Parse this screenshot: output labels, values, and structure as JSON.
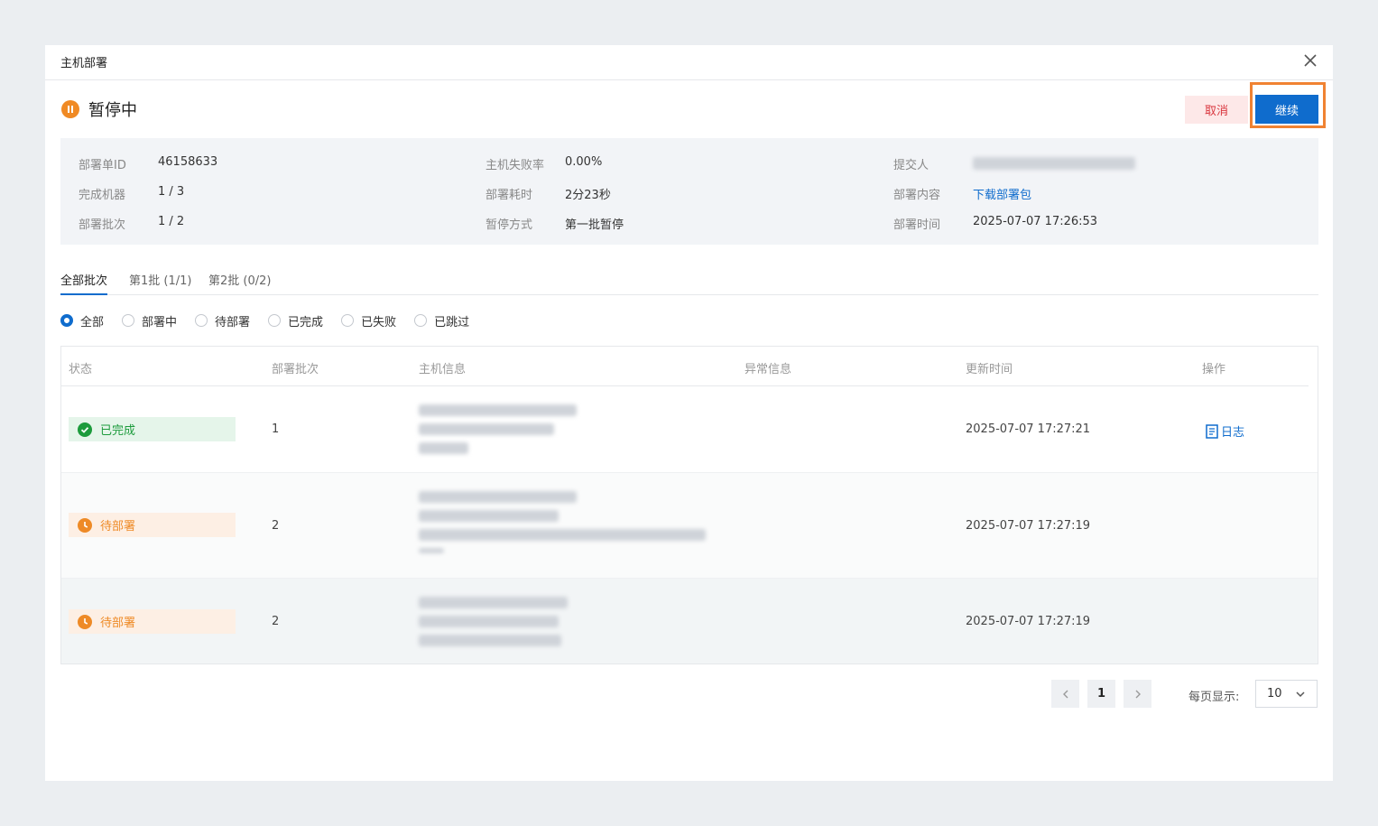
{
  "dialog": {
    "title": "主机部署"
  },
  "status": {
    "text": "暂停中"
  },
  "actions": {
    "cancel_label": "取消",
    "continue_label": "继续"
  },
  "info": {
    "deploy_id_label": "部署单ID",
    "deploy_id": "46158633",
    "machines_label": "完成机器",
    "machines": "1 / 3",
    "batch_label": "部署批次",
    "batch": "1 / 2",
    "fail_rate_label": "主机失败率",
    "fail_rate": "0.00%",
    "duration_label": "部署耗时",
    "duration": "2分23秒",
    "pause_mode_label": "暂停方式",
    "pause_mode": "第一批暂停",
    "submitter_label": "提交人",
    "content_label": "部署内容",
    "content_link": "下载部署包",
    "time_label": "部署时间",
    "time": "2025-07-07 17:26:53"
  },
  "tabs": [
    {
      "label": "全部批次",
      "active": true
    },
    {
      "label": "第1批 (1/1)",
      "active": false
    },
    {
      "label": "第2批 (0/2)",
      "active": false
    }
  ],
  "filters": [
    {
      "label": "全部",
      "checked": true
    },
    {
      "label": "部署中",
      "checked": false
    },
    {
      "label": "待部署",
      "checked": false
    },
    {
      "label": "已完成",
      "checked": false
    },
    {
      "label": "已失败",
      "checked": false
    },
    {
      "label": "已跳过",
      "checked": false
    }
  ],
  "table": {
    "columns": [
      "状态",
      "部署批次",
      "主机信息",
      "异常信息",
      "更新时间",
      "操作"
    ],
    "rows": [
      {
        "status": "已完成",
        "batch": "1",
        "updated": "2025-07-07 17:27:21",
        "action": "日志"
      },
      {
        "status": "待部署",
        "batch": "2",
        "updated": "2025-07-07 17:27:19",
        "action": ""
      },
      {
        "status": "待部署",
        "batch": "2",
        "updated": "2025-07-07 17:27:19",
        "action": ""
      }
    ]
  },
  "pagination": {
    "current_page": "1",
    "per_page_label": "每页显示:",
    "per_page": "10"
  },
  "colors": {
    "primary": "#0f6ccd",
    "success": "#1c9b3c",
    "warning": "#ee8a26",
    "danger": "#d9363e",
    "highlight": "#f08232"
  },
  "icons": [
    "close-icon",
    "pause-icon",
    "check-circle-icon",
    "clock-icon",
    "log-icon",
    "chevron-left-icon",
    "chevron-right-icon",
    "chevron-down-icon"
  ]
}
